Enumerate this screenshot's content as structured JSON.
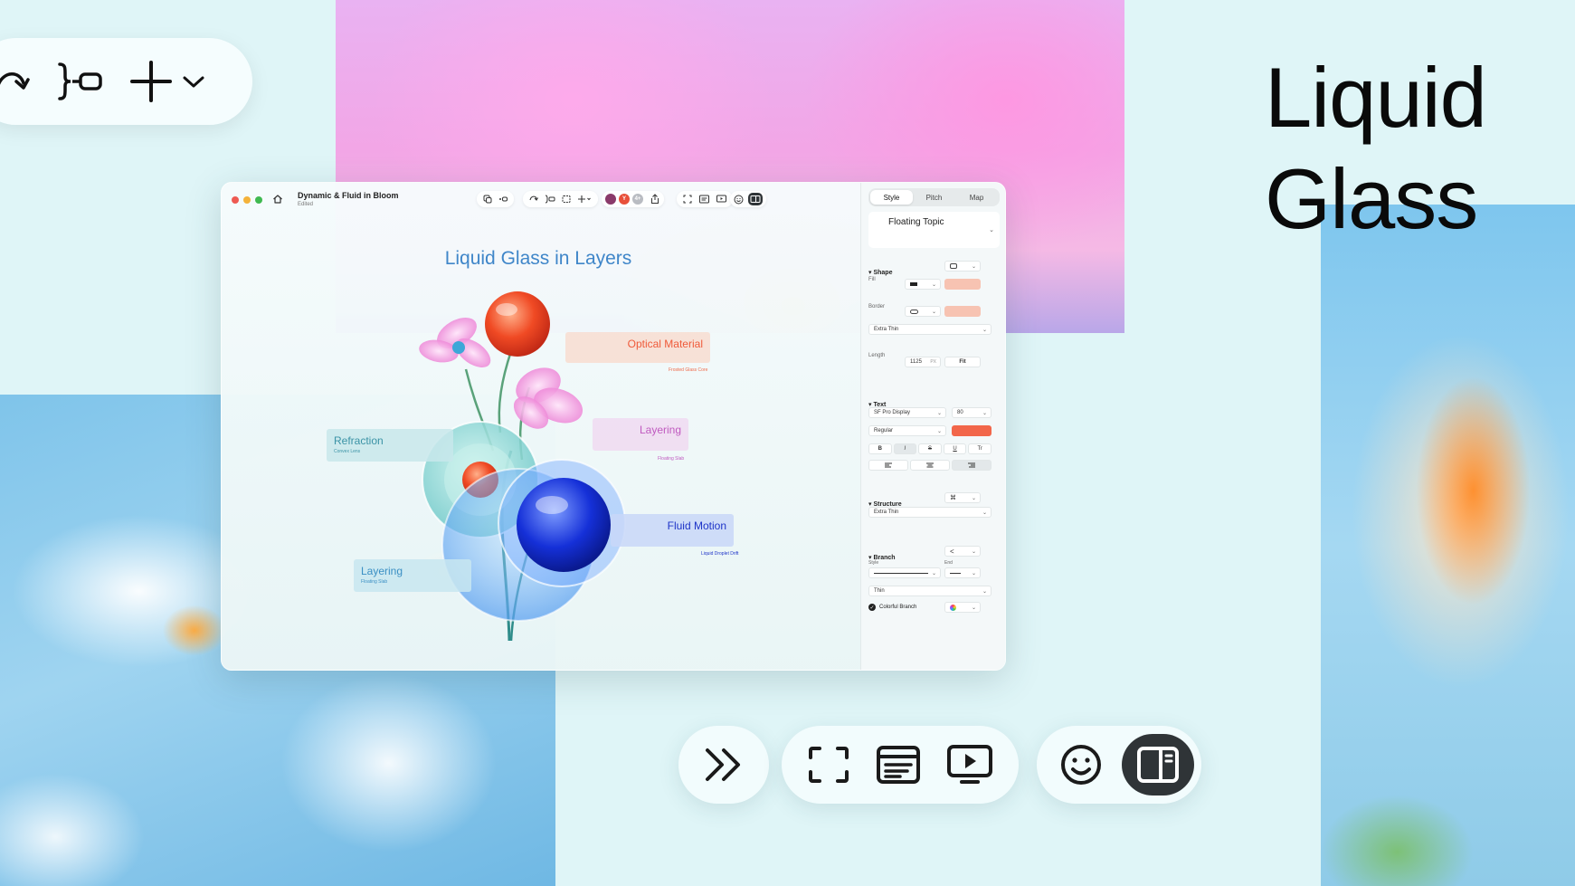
{
  "hero": {
    "line1": "Liquid",
    "line2": "Glass"
  },
  "top_toolbar": {
    "icons": [
      "redo-icon",
      "summary-icon",
      "add-icon",
      "chevron-down-icon"
    ]
  },
  "window": {
    "title": "Dynamic & Fluid in Bloom",
    "subtitle": "Edited",
    "avatars": [
      {
        "letter": "",
        "color": "#c0405a"
      },
      {
        "letter": "Y",
        "color": "#e8503a"
      },
      {
        "letter": "4+",
        "color": "#b9bcc2"
      }
    ]
  },
  "canvas": {
    "title": "Liquid Glass in Layers",
    "topics": {
      "optical": {
        "label": "Optical Material",
        "sub": "Frosted Glass Core"
      },
      "layering_right": {
        "label": "Layering",
        "sub": "Floating Slab"
      },
      "refraction": {
        "label": "Refraction",
        "sub": "Convex Lens"
      },
      "fluid": {
        "label": "Fluid Motion",
        "sub": "Liquid Droplet Drift"
      },
      "layering_left": {
        "label": "Layering",
        "sub": "Floating Slab"
      }
    }
  },
  "panel": {
    "tabs": [
      "Style",
      "Pitch",
      "Map"
    ],
    "topic_name": "Floating Topic",
    "shape": {
      "heading": "Shape",
      "fill_label": "Fill",
      "border_label": "Border",
      "border_weight": "Extra Thin",
      "length_label": "Length",
      "length_value": "1125",
      "length_unit": "PX",
      "fit_label": "Fit",
      "fill_color": "#f7c3b2",
      "border_color": "#f7c3b2"
    },
    "text": {
      "heading": "Text",
      "font": "SF Pro Display",
      "size": "80",
      "weight": "Regular",
      "color": "#f2664a",
      "styles": [
        "B",
        "I",
        "S",
        "U",
        "Tr"
      ]
    },
    "structure": {
      "heading": "Structure",
      "value": "Extra Thin"
    },
    "branch": {
      "heading": "Branch",
      "style_label": "Style",
      "end_label": "End",
      "weight": "Thin",
      "colorful_label": "Colorful Branch",
      "colorful_checked": true
    }
  },
  "bottom_toolbar": {
    "icons": [
      "collapse-icon",
      "focus-icon",
      "outline-icon",
      "present-icon",
      "emoji-icon",
      "sidebar-icon"
    ]
  }
}
